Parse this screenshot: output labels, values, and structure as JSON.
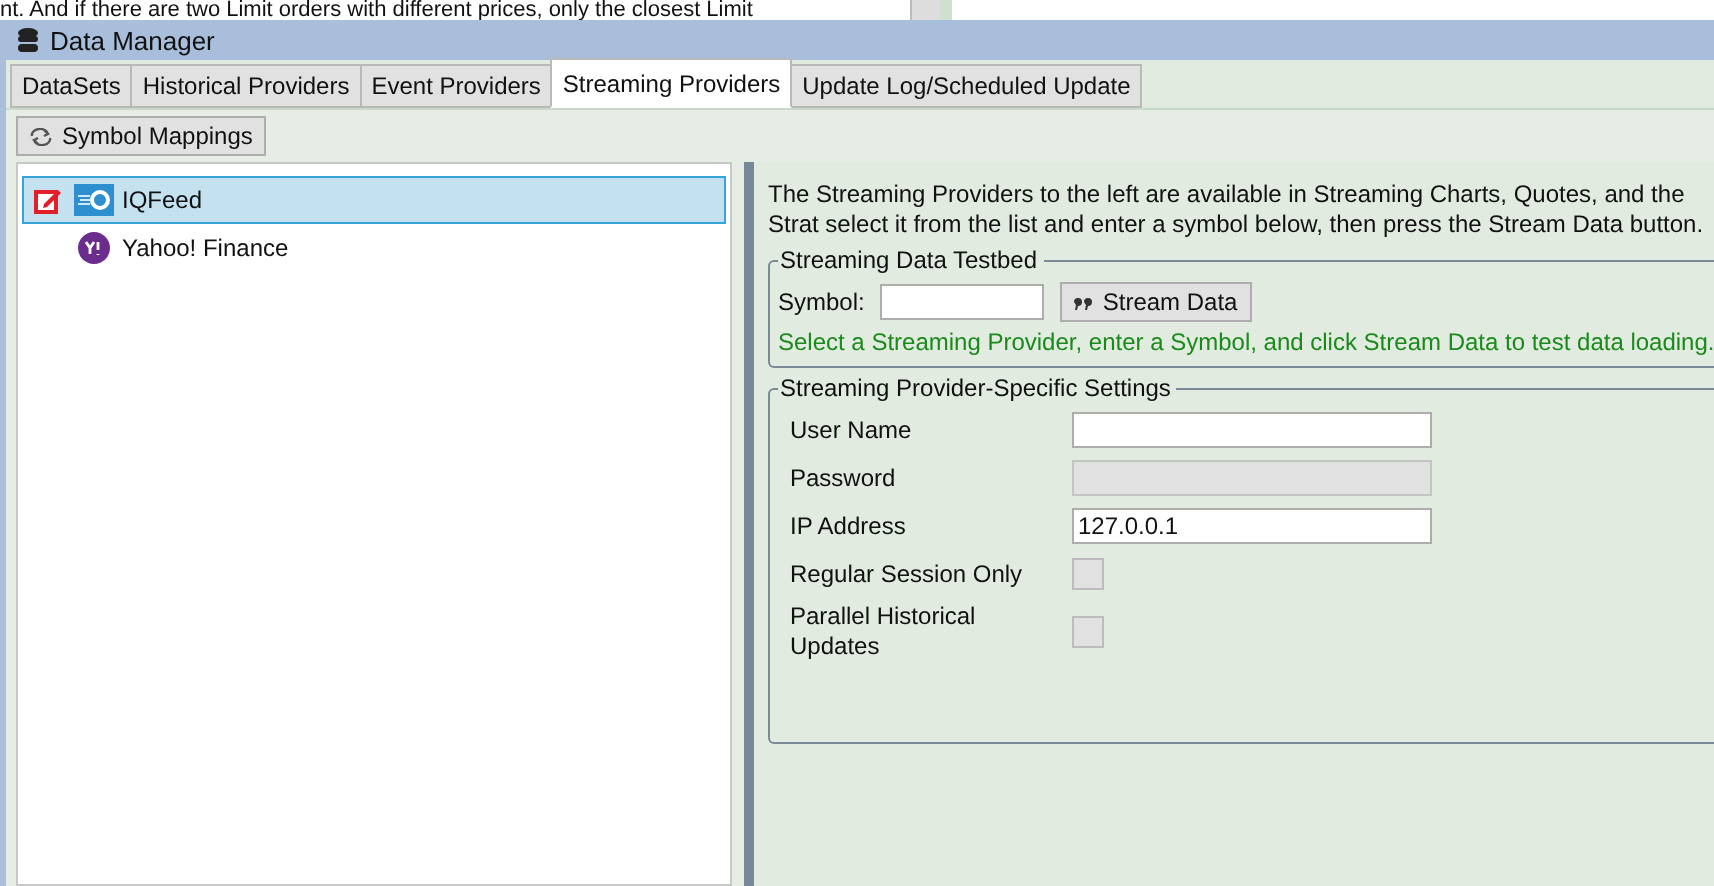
{
  "background_text": "nt. And if there are two Limit orders with different prices, only the closest Limit",
  "window": {
    "title": "Data Manager"
  },
  "tabs": [
    {
      "label": "DataSets",
      "selected": false
    },
    {
      "label": "Historical Providers",
      "selected": false
    },
    {
      "label": "Event Providers",
      "selected": false
    },
    {
      "label": "Streaming Providers",
      "selected": true
    },
    {
      "label": "Update Log/Scheduled Update",
      "selected": false
    }
  ],
  "toolbar": {
    "buttons": [
      "Symbol Mappings"
    ]
  },
  "providers": [
    {
      "name": "IQFeed",
      "selected": true,
      "editing": true,
      "kind": "iqfeed"
    },
    {
      "name": "Yahoo! Finance",
      "selected": false,
      "editing": false,
      "kind": "yahoo"
    }
  ],
  "description": "The Streaming Providers to the left are available in Streaming Charts, Quotes, and the Strat select it from the list and enter a symbol below, then press the Stream Data button.",
  "testbed": {
    "title": "Streaming Data Testbed",
    "symbol_label": "Symbol:",
    "button": "Stream Data",
    "hint": "Select a Streaming Provider, enter a Symbol, and click Stream Data to test data loading."
  },
  "settings": {
    "title": "Streaming Provider-Specific Settings",
    "fields": [
      {
        "kind": "text",
        "label": "User Name",
        "disabled": false
      },
      {
        "kind": "text",
        "label": "Password",
        "disabled": true
      },
      {
        "kind": "text",
        "label": "IP Address",
        "value": "127.0.0.1",
        "disabled": false
      },
      {
        "kind": "checkbox",
        "label": "Regular Session Only",
        "checked": false
      },
      {
        "kind": "checkbox",
        "label": "Parallel Historical Updates",
        "checked": false
      }
    ]
  }
}
